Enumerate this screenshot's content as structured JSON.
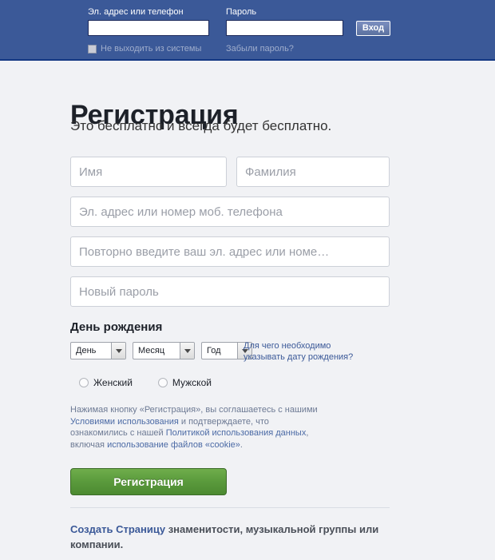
{
  "topbar": {
    "email_label": "Эл. адрес или телефон",
    "email_value": "",
    "password_label": "Пароль",
    "password_value": "",
    "login_button": "Вход",
    "keep_logged_in": "Не выходить из системы",
    "forgot_password": "Забыли пароль?"
  },
  "signup": {
    "title": "Регистрация",
    "subtitle": "Это бесплатно и всегда будет бесплатно.",
    "fields": {
      "first_name": "Имя",
      "last_name": "Фамилия",
      "email": "Эл. адрес или номер моб. телефона",
      "email_confirm": "Повторно введите ваш эл. адрес или номе…",
      "password": "Новый пароль"
    },
    "birthday": {
      "title": "День рождения",
      "day": "День",
      "month": "Месяц",
      "year": "Год",
      "why_link_line1": "Для чего необходимо",
      "why_link_line2": "указывать дату рождения?"
    },
    "gender": {
      "female": "Женский",
      "male": "Мужской",
      "selected": ""
    },
    "legal": {
      "part1": "Нажимая кнопку «Регистрация», вы соглашаетесь с нашими ",
      "link1": "Условиями использования",
      "part2": " и подтверждаете, что ознакомились с нашей ",
      "link2": "Политикой использования данных",
      "part3": ", включая ",
      "link3": "использование файлов «cookie»",
      "part4": "."
    },
    "submit_button": "Регистрация"
  },
  "footer": {
    "link": "Создать Страницу",
    "text": " знаменитости, музыкальной группы или компании."
  },
  "colors": {
    "brand_blue": "#3b5998",
    "signup_green": "#5a9a3c",
    "page_background": "#f1f2f5",
    "link_blue": "#4b6aa5"
  }
}
